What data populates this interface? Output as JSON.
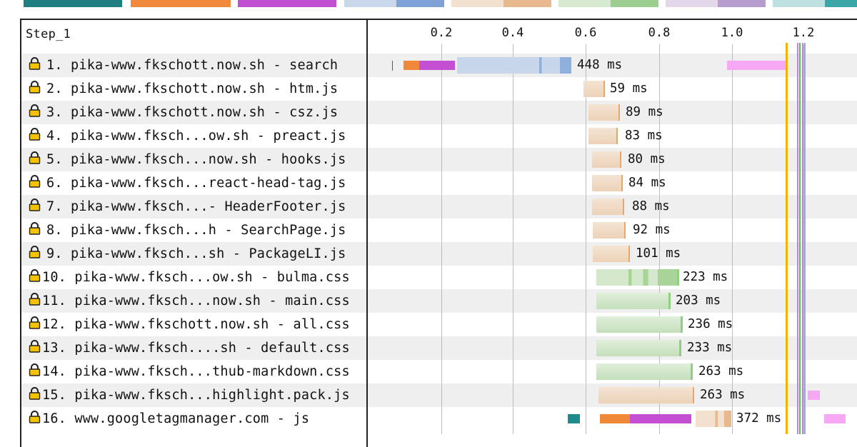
{
  "step_title": "Step_1",
  "axis_ticks": [
    "0.2",
    "0.4",
    "0.6",
    "0.8",
    "1.0",
    "1.2"
  ],
  "colors": {
    "html": "#b8cce4",
    "js": "#f0d8bf",
    "css": "#c9e2c0",
    "dns": "#1f8a8a",
    "connect": "#f0883a",
    "ssl": "#c34fd2",
    "js_exec": "#f7a8f4",
    "start_render": "#f2b400",
    "dom_interactive": "#b98ad6",
    "dom_loaded": "#6ab06a"
  },
  "requests": [
    {
      "n": "1.",
      "label": "pika-www.fkschott.now.sh - search",
      "time": "448 ms"
    },
    {
      "n": "2.",
      "label": "pika-www.fkschott.now.sh - htm.js",
      "time": "59 ms"
    },
    {
      "n": "3.",
      "label": "pika-www.fkschott.now.sh - csz.js",
      "time": "89 ms"
    },
    {
      "n": "4.",
      "label": "pika-www.fksch...ow.sh - preact.js",
      "time": "83 ms"
    },
    {
      "n": "5.",
      "label": "pika-www.fksch...now.sh - hooks.js",
      "time": "80 ms"
    },
    {
      "n": "6.",
      "label": "pika-www.fksch...react-head-tag.js",
      "time": "84 ms"
    },
    {
      "n": "7.",
      "label": "pika-www.fksch...- HeaderFooter.js",
      "time": "88 ms"
    },
    {
      "n": "8.",
      "label": "pika-www.fksch...h - SearchPage.js",
      "time": "92 ms"
    },
    {
      "n": "9.",
      "label": "pika-www.fksch...sh - PackageLI.js",
      "time": "101 ms"
    },
    {
      "n": "10.",
      "label": "pika-www.fksch...ow.sh - bulma.css",
      "time": "223 ms"
    },
    {
      "n": "11.",
      "label": "pika-www.fksch...now.sh - main.css",
      "time": "203 ms"
    },
    {
      "n": "12.",
      "label": "pika-www.fkschott.now.sh - all.css",
      "time": "236 ms"
    },
    {
      "n": "13.",
      "label": "pika-www.fksch....sh - default.css",
      "time": "233 ms"
    },
    {
      "n": "14.",
      "label": "pika-www.fksch...thub-markdown.css",
      "time": "263 ms"
    },
    {
      "n": "15.",
      "label": "pika-www.fksch...highlight.pack.js",
      "time": "263 ms"
    },
    {
      "n": "16.",
      "label": "www.googletagmanager.com - js",
      "time": "372 ms"
    }
  ]
}
